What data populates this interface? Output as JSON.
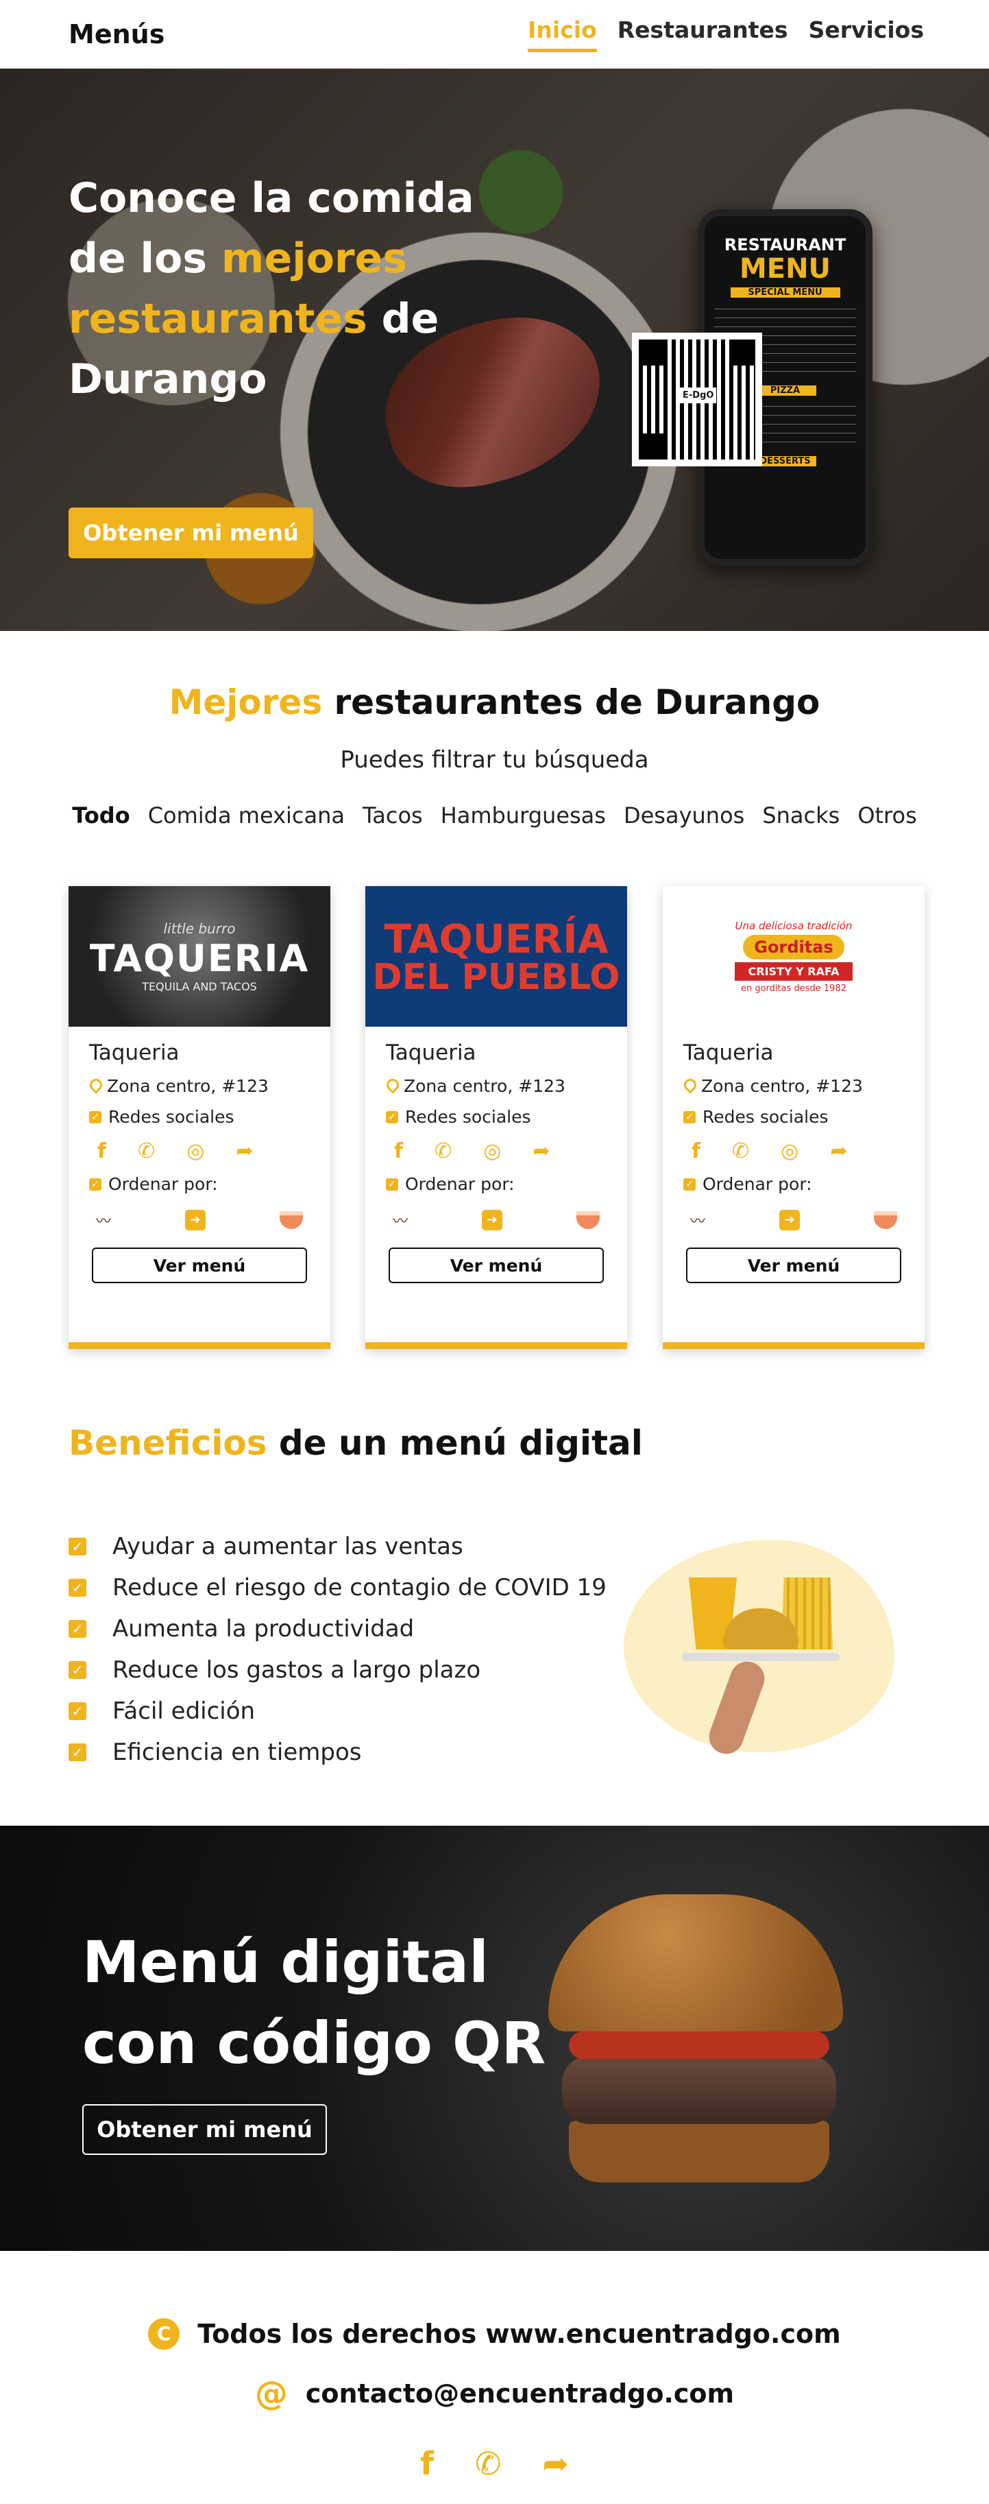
{
  "nav": {
    "brand": "Menús",
    "links": [
      "Inicio",
      "Restaurantes",
      "Servicios"
    ]
  },
  "hero": {
    "title_a": "Conoce la comida de los ",
    "title_hl": "mejores restaurantes",
    "title_b": " de Durango",
    "button": "Obtener mi menú",
    "phone_title1": "RESTAURANT",
    "phone_title2": "MENU",
    "phone_special": "SPECIAL MENU",
    "phone_pizza": "PIZZA",
    "phone_desserts": "DESSERTS",
    "qr_label": "E-DgO"
  },
  "restaurants": {
    "title_hl": "Mejores",
    "title_rest": " restaurantes de Durango",
    "subtitle": "Puedes filtrar tu búsqueda",
    "filters": [
      "Todo",
      "Comida mexicana",
      "Tacos",
      "Hamburguesas",
      "Desayunos",
      "Snacks",
      "Otros"
    ],
    "cards": [
      {
        "name": "Taqueria",
        "address": "Zona centro, #123",
        "social_label": "Redes sociales",
        "order_label": "Ordenar por:",
        "button": "Ver menú",
        "logo_a": "little burro",
        "logo_b": "TAQUERIA",
        "logo_c": "TEQUILA AND TACOS"
      },
      {
        "name": "Taqueria",
        "address": "Zona centro, #123",
        "social_label": "Redes sociales",
        "order_label": "Ordenar por:",
        "button": "Ver menú",
        "logo_a": "TAQUERÍA",
        "logo_b": "DEL PUEBLO"
      },
      {
        "name": "Taqueria",
        "address": "Zona centro, #123",
        "social_label": "Redes sociales",
        "order_label": "Ordenar por:",
        "button": "Ver menú",
        "logo_a": "Una deliciosa tradición",
        "logo_b": "Gorditas",
        "logo_c": "CRISTY Y RAFA",
        "logo_d": "en gorditas desde 1982"
      }
    ]
  },
  "benefits": {
    "title_hl": "Beneficios",
    "title_rest": " de un menú digital",
    "items": [
      "Ayudar a aumentar las ventas",
      "Reduce el riesgo de contagio de COVID 19",
      "Aumenta la productividad",
      "Reduce los gastos a largo plazo",
      "Fácil edición",
      "Eficiencia en tiempos"
    ]
  },
  "banner": {
    "title": "Menú digital con código QR",
    "button": "Obtener mi menú"
  },
  "footer": {
    "copyright": "Todos los derechos www.encuentradgo.com",
    "email": "contacto@encuentradgo.com"
  },
  "colors": {
    "accent": "#f0b41d"
  }
}
